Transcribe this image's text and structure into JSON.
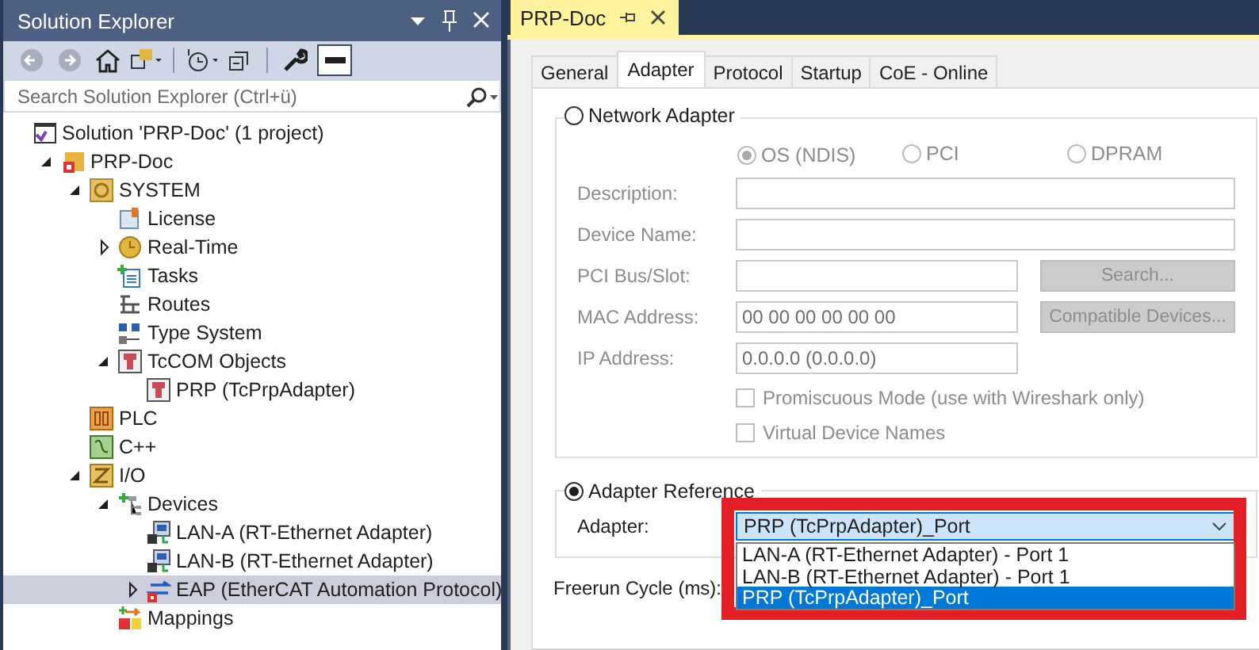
{
  "explorer": {
    "title": "Solution Explorer",
    "search": {
      "placeholder": "Search Solution Explorer (Ctrl+ü)"
    },
    "tree": [
      {
        "label": "Solution 'PRP-Doc' (1 project)",
        "kind": "solution",
        "selected": false,
        "children": [
          {
            "label": "PRP-Doc",
            "kind": "project",
            "expanded": true,
            "selected": false,
            "children": [
              {
                "label": "SYSTEM",
                "kind": "system",
                "expanded": true,
                "selected": false,
                "children": [
                  {
                    "label": "License",
                    "kind": "license",
                    "selected": false
                  },
                  {
                    "label": "Real-Time",
                    "kind": "realtime",
                    "expanded": false,
                    "selected": false
                  },
                  {
                    "label": "Tasks",
                    "kind": "tasks",
                    "selected": false
                  },
                  {
                    "label": "Routes",
                    "kind": "routes",
                    "selected": false
                  },
                  {
                    "label": "Type System",
                    "kind": "types",
                    "selected": false
                  },
                  {
                    "label": "TcCOM Objects",
                    "kind": "tcom",
                    "expanded": true,
                    "selected": false,
                    "children": [
                      {
                        "label": "PRP (TcPrpAdapter)",
                        "kind": "tcom",
                        "selected": false
                      }
                    ]
                  }
                ]
              },
              {
                "label": "PLC",
                "kind": "plc",
                "selected": false
              },
              {
                "label": "C++",
                "kind": "cpp",
                "selected": false
              },
              {
                "label": "I/O",
                "kind": "io",
                "expanded": true,
                "selected": false,
                "children": [
                  {
                    "label": "Devices",
                    "kind": "devices",
                    "expanded": true,
                    "selected": false,
                    "children": [
                      {
                        "label": "LAN-A (RT-Ethernet Adapter)",
                        "kind": "adapter",
                        "selected": false
                      },
                      {
                        "label": "LAN-B (RT-Ethernet Adapter)",
                        "kind": "adapter",
                        "selected": false
                      },
                      {
                        "label": "EAP (EtherCAT Automation Protocol)",
                        "kind": "eap",
                        "expanded": false,
                        "selected": true
                      }
                    ]
                  },
                  {
                    "label": "Mappings",
                    "kind": "mappings",
                    "selected": false
                  }
                ]
              }
            ]
          }
        ]
      }
    ]
  },
  "document": {
    "title": "PRP-Doc",
    "tabs": [
      {
        "label": "General",
        "selected": false
      },
      {
        "label": "Adapter",
        "selected": true
      },
      {
        "label": "Protocol",
        "selected": false
      },
      {
        "label": "Startup",
        "selected": false
      },
      {
        "label": "CoE - Online",
        "selected": false
      }
    ],
    "network_adapter": {
      "label": "Network Adapter",
      "selected": false,
      "disabled": true,
      "options": [
        {
          "label": "OS (NDIS)",
          "selected": true
        },
        {
          "label": "PCI",
          "selected": false
        },
        {
          "label": "DPRAM",
          "selected": false
        }
      ],
      "fields": [
        {
          "label": "Description:",
          "wide": true
        },
        {
          "label": "Device Name:",
          "wide": true
        },
        {
          "label": "PCI Bus/Slot:",
          "button": "Search..."
        },
        {
          "label": "MAC Address:",
          "value": "00 00 00 00 00 00",
          "button": "Compatible Devices..."
        },
        {
          "label": "IP Address:",
          "value": "0.0.0.0 (0.0.0.0)"
        }
      ],
      "checkboxes": [
        {
          "label": "Promiscuous Mode (use with Wireshark only)",
          "checked": false
        },
        {
          "label": "Virtual Device Names",
          "checked": false
        }
      ]
    },
    "adapter_reference": {
      "label": "Adapter Reference",
      "selected": true,
      "highlighted": true,
      "adapter": {
        "label": "Adapter:",
        "value": "PRP (TcPrpAdapter)_Port",
        "expanded": true,
        "options": [
          {
            "label": "LAN-A (RT-Ethernet Adapter) - Port 1",
            "selected": false
          },
          {
            "label": "LAN-B (RT-Ethernet Adapter) - Port 1",
            "selected": false
          },
          {
            "label": "PRP (TcPrpAdapter)_Port",
            "selected": true
          }
        ]
      }
    },
    "freerun": {
      "label": "Freerun Cycle (ms):"
    }
  }
}
